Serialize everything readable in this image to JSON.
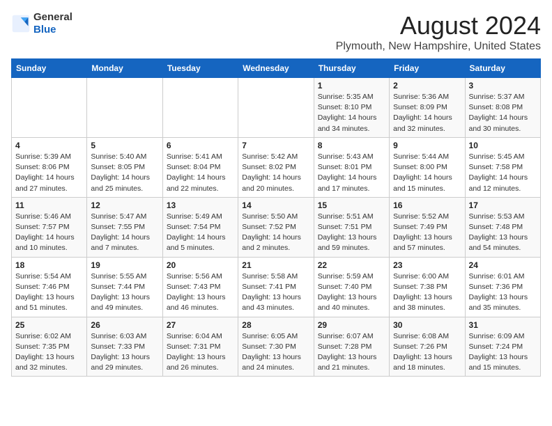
{
  "header": {
    "logo_general": "General",
    "logo_blue": "Blue",
    "month_title": "August 2024",
    "location": "Plymouth, New Hampshire, United States"
  },
  "weekdays": [
    "Sunday",
    "Monday",
    "Tuesday",
    "Wednesday",
    "Thursday",
    "Friday",
    "Saturday"
  ],
  "weeks": [
    [
      {
        "day": "",
        "info": ""
      },
      {
        "day": "",
        "info": ""
      },
      {
        "day": "",
        "info": ""
      },
      {
        "day": "",
        "info": ""
      },
      {
        "day": "1",
        "info": "Sunrise: 5:35 AM\nSunset: 8:10 PM\nDaylight: 14 hours\nand 34 minutes."
      },
      {
        "day": "2",
        "info": "Sunrise: 5:36 AM\nSunset: 8:09 PM\nDaylight: 14 hours\nand 32 minutes."
      },
      {
        "day": "3",
        "info": "Sunrise: 5:37 AM\nSunset: 8:08 PM\nDaylight: 14 hours\nand 30 minutes."
      }
    ],
    [
      {
        "day": "4",
        "info": "Sunrise: 5:39 AM\nSunset: 8:06 PM\nDaylight: 14 hours\nand 27 minutes."
      },
      {
        "day": "5",
        "info": "Sunrise: 5:40 AM\nSunset: 8:05 PM\nDaylight: 14 hours\nand 25 minutes."
      },
      {
        "day": "6",
        "info": "Sunrise: 5:41 AM\nSunset: 8:04 PM\nDaylight: 14 hours\nand 22 minutes."
      },
      {
        "day": "7",
        "info": "Sunrise: 5:42 AM\nSunset: 8:02 PM\nDaylight: 14 hours\nand 20 minutes."
      },
      {
        "day": "8",
        "info": "Sunrise: 5:43 AM\nSunset: 8:01 PM\nDaylight: 14 hours\nand 17 minutes."
      },
      {
        "day": "9",
        "info": "Sunrise: 5:44 AM\nSunset: 8:00 PM\nDaylight: 14 hours\nand 15 minutes."
      },
      {
        "day": "10",
        "info": "Sunrise: 5:45 AM\nSunset: 7:58 PM\nDaylight: 14 hours\nand 12 minutes."
      }
    ],
    [
      {
        "day": "11",
        "info": "Sunrise: 5:46 AM\nSunset: 7:57 PM\nDaylight: 14 hours\nand 10 minutes."
      },
      {
        "day": "12",
        "info": "Sunrise: 5:47 AM\nSunset: 7:55 PM\nDaylight: 14 hours\nand 7 minutes."
      },
      {
        "day": "13",
        "info": "Sunrise: 5:49 AM\nSunset: 7:54 PM\nDaylight: 14 hours\nand 5 minutes."
      },
      {
        "day": "14",
        "info": "Sunrise: 5:50 AM\nSunset: 7:52 PM\nDaylight: 14 hours\nand 2 minutes."
      },
      {
        "day": "15",
        "info": "Sunrise: 5:51 AM\nSunset: 7:51 PM\nDaylight: 13 hours\nand 59 minutes."
      },
      {
        "day": "16",
        "info": "Sunrise: 5:52 AM\nSunset: 7:49 PM\nDaylight: 13 hours\nand 57 minutes."
      },
      {
        "day": "17",
        "info": "Sunrise: 5:53 AM\nSunset: 7:48 PM\nDaylight: 13 hours\nand 54 minutes."
      }
    ],
    [
      {
        "day": "18",
        "info": "Sunrise: 5:54 AM\nSunset: 7:46 PM\nDaylight: 13 hours\nand 51 minutes."
      },
      {
        "day": "19",
        "info": "Sunrise: 5:55 AM\nSunset: 7:44 PM\nDaylight: 13 hours\nand 49 minutes."
      },
      {
        "day": "20",
        "info": "Sunrise: 5:56 AM\nSunset: 7:43 PM\nDaylight: 13 hours\nand 46 minutes."
      },
      {
        "day": "21",
        "info": "Sunrise: 5:58 AM\nSunset: 7:41 PM\nDaylight: 13 hours\nand 43 minutes."
      },
      {
        "day": "22",
        "info": "Sunrise: 5:59 AM\nSunset: 7:40 PM\nDaylight: 13 hours\nand 40 minutes."
      },
      {
        "day": "23",
        "info": "Sunrise: 6:00 AM\nSunset: 7:38 PM\nDaylight: 13 hours\nand 38 minutes."
      },
      {
        "day": "24",
        "info": "Sunrise: 6:01 AM\nSunset: 7:36 PM\nDaylight: 13 hours\nand 35 minutes."
      }
    ],
    [
      {
        "day": "25",
        "info": "Sunrise: 6:02 AM\nSunset: 7:35 PM\nDaylight: 13 hours\nand 32 minutes."
      },
      {
        "day": "26",
        "info": "Sunrise: 6:03 AM\nSunset: 7:33 PM\nDaylight: 13 hours\nand 29 minutes."
      },
      {
        "day": "27",
        "info": "Sunrise: 6:04 AM\nSunset: 7:31 PM\nDaylight: 13 hours\nand 26 minutes."
      },
      {
        "day": "28",
        "info": "Sunrise: 6:05 AM\nSunset: 7:30 PM\nDaylight: 13 hours\nand 24 minutes."
      },
      {
        "day": "29",
        "info": "Sunrise: 6:07 AM\nSunset: 7:28 PM\nDaylight: 13 hours\nand 21 minutes."
      },
      {
        "day": "30",
        "info": "Sunrise: 6:08 AM\nSunset: 7:26 PM\nDaylight: 13 hours\nand 18 minutes."
      },
      {
        "day": "31",
        "info": "Sunrise: 6:09 AM\nSunset: 7:24 PM\nDaylight: 13 hours\nand 15 minutes."
      }
    ]
  ]
}
